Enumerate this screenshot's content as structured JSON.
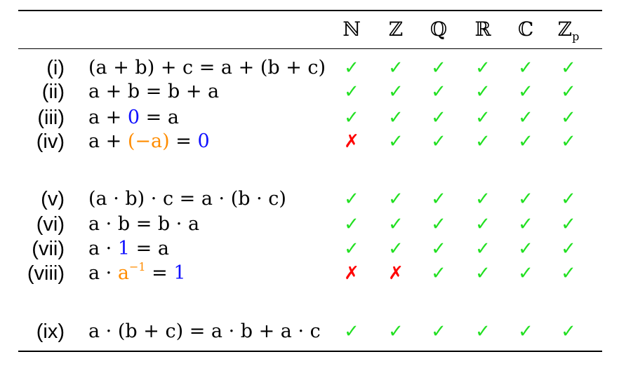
{
  "headers": [
    {
      "main": "ℕ",
      "sub": ""
    },
    {
      "main": "ℤ",
      "sub": ""
    },
    {
      "main": "ℚ",
      "sub": ""
    },
    {
      "main": "ℝ",
      "sub": ""
    },
    {
      "main": "ℂ",
      "sub": ""
    },
    {
      "main": "ℤ",
      "sub": "p"
    }
  ],
  "rows": [
    {
      "label": "(i)",
      "segments": [
        {
          "text": "(a + b) + c = a + (b + c)"
        }
      ],
      "marks": [
        "✓",
        "✓",
        "✓",
        "✓",
        "✓",
        "✓"
      ]
    },
    {
      "label": "(ii)",
      "segments": [
        {
          "text": "a + b = b + a"
        }
      ],
      "marks": [
        "✓",
        "✓",
        "✓",
        "✓",
        "✓",
        "✓"
      ]
    },
    {
      "label": "(iii)",
      "segments": [
        {
          "text": "a + "
        },
        {
          "text": "0",
          "color": "blue"
        },
        {
          "text": " = a"
        }
      ],
      "marks": [
        "✓",
        "✓",
        "✓",
        "✓",
        "✓",
        "✓"
      ]
    },
    {
      "label": "(iv)",
      "segments": [
        {
          "text": "a + "
        },
        {
          "text": "(−a)",
          "color": "orange"
        },
        {
          "text": " = "
        },
        {
          "text": "0",
          "color": "blue"
        }
      ],
      "marks": [
        "✗",
        "✓",
        "✓",
        "✓",
        "✓",
        "✓"
      ]
    },
    {
      "label": "(v)",
      "segments": [
        {
          "text": "(a · b) · c = a · (b · c)"
        }
      ],
      "marks": [
        "✓",
        "✓",
        "✓",
        "✓",
        "✓",
        "✓"
      ]
    },
    {
      "label": "(vi)",
      "segments": [
        {
          "text": "a · b = b · a"
        }
      ],
      "marks": [
        "✓",
        "✓",
        "✓",
        "✓",
        "✓",
        "✓"
      ]
    },
    {
      "label": "(vii)",
      "segments": [
        {
          "text": "a · "
        },
        {
          "text": "1",
          "color": "blue"
        },
        {
          "text": " = a"
        }
      ],
      "marks": [
        "✓",
        "✓",
        "✓",
        "✓",
        "✓",
        "✓"
      ]
    },
    {
      "label": "(viii)",
      "segments": [
        {
          "text": "a · "
        },
        {
          "text": "a",
          "color": "orange",
          "sup": "−1"
        },
        {
          "text": " = "
        },
        {
          "text": "1",
          "color": "blue"
        }
      ],
      "marks": [
        "✗",
        "✗",
        "✓",
        "✓",
        "✓",
        "✓"
      ]
    },
    {
      "label": "(ix)",
      "segments": [
        {
          "text": "a · (b + c) = a · b + a · c"
        }
      ],
      "marks": [
        "✓",
        "✓",
        "✓",
        "✓",
        "✓",
        "✓"
      ]
    }
  ],
  "colors": {
    "check": "#22e022",
    "cross": "#ff0000",
    "blue": "#1010ff",
    "orange": "#ff8c00"
  }
}
